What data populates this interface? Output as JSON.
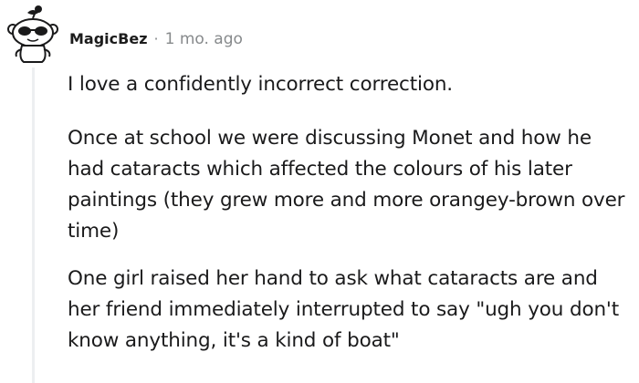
{
  "comment": {
    "username": "MagicBez",
    "separator": "·",
    "timestamp": "1 mo. ago",
    "paragraphs": [
      "I love a confidently incorrect correction.",
      "Once at school we were discussing Monet and how he had cataracts which affected the colours of his later paintings (they grew more and more orangey-brown over time)",
      "One girl raised her hand to ask what cataracts are and her friend immediately interrupted to say \"ugh you don't know anything, it's a kind of boat\""
    ]
  },
  "avatar": {
    "icon": "snoo-avatar-with-sunglasses"
  },
  "colors": {
    "text": "#1a1a1b",
    "meta": "#878a8c",
    "thread_line": "#edeff1"
  }
}
